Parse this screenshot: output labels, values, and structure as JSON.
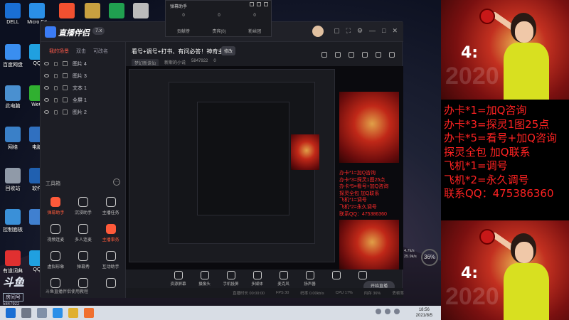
{
  "desktop": {
    "icons": [
      {
        "label": "DELL",
        "color": "#1a6fd4"
      },
      {
        "label": "Micro Ed",
        "color": "#2a8fe8"
      },
      {
        "label": "",
        "color": "#f25030"
      },
      {
        "label": "",
        "color": "#c8a040"
      },
      {
        "label": "",
        "color": "#20a050"
      },
      {
        "label": "",
        "color": "#bbbbbb"
      },
      {
        "label": "百度网盘",
        "color": "#3a8ef0"
      },
      {
        "label": "QQ",
        "color": "#20a0e0"
      },
      {
        "label": "此电脑",
        "color": "#4a90d0"
      },
      {
        "label": "WeC",
        "color": "#30b030"
      },
      {
        "label": "网络",
        "color": "#3a80c8"
      },
      {
        "label": "电脑",
        "color": "#3070c0"
      },
      {
        "label": "回收站",
        "color": "#909aa8"
      },
      {
        "label": "软件",
        "color": "#2060b0"
      },
      {
        "label": "控制面板",
        "color": "#3a90d8"
      },
      {
        "label": "",
        "color": "#4080d0"
      },
      {
        "label": "有道词典",
        "color": "#e03030"
      },
      {
        "label": "QQ",
        "color": "#20a0e0"
      }
    ]
  },
  "app": {
    "name": "直播伴侣",
    "version": "7.x",
    "controls": [
      "▢",
      "⛶",
      "⚙",
      "—",
      "□",
      "✕"
    ],
    "tabs": [
      {
        "label": "我的场景",
        "active": true
      },
      {
        "label": "双击",
        "active": false
      },
      {
        "label": "可改名",
        "active": false
      }
    ],
    "scene_items": [
      "图片 4",
      "图片 3",
      "文本 1",
      "全屏 1",
      "图片 2"
    ],
    "toolbox_title": "工具箱",
    "tools": [
      {
        "label": "弹幕助手",
        "red": true
      },
      {
        "label": "沉浸助手",
        "red": false
      },
      {
        "label": "主播任务",
        "red": false
      },
      {
        "label": "视频连麦",
        "red": false
      },
      {
        "label": "多人连麦",
        "red": false
      },
      {
        "label": "主播事务",
        "red": true
      },
      {
        "label": "虚拟形象",
        "red": false
      },
      {
        "label": "弹幕秀",
        "red": false
      },
      {
        "label": "互动助手",
        "red": false
      },
      {
        "label": "",
        "red": false
      },
      {
        "label": "",
        "red": false
      },
      {
        "label": "",
        "red": false
      }
    ],
    "sidebar_footer": "斗鱼直播伴侣使用教程",
    "room": {
      "title": "看号+调号+打书、有问必答！神奇主播！",
      "edit_label": "修改",
      "category": "梦幻新诛仙",
      "streamer": "新斯的小说",
      "room_id": "5847922",
      "likes": "0"
    },
    "bottom_tools": [
      "资源屏幕",
      "摄像头",
      "手机投屏",
      "多媒体",
      "麦克风",
      "扬声器",
      "",
      ""
    ],
    "live_button": "开始直播",
    "status": [
      "直播时长 00:00:00",
      "FPS 30",
      "码率 0.00kb/s",
      "CPU 17%",
      "内存 36%",
      "丢帧率"
    ]
  },
  "popup": {
    "title": "弹幕助手",
    "counts": [
      "0",
      "0",
      "0"
    ],
    "tabs": [
      "贡献榜",
      "贵宾(0)",
      "粉丝团"
    ]
  },
  "right_panel": {
    "score_text": "4:",
    "year_text": "2020",
    "lines": [
      "办卡*1=加Q咨询",
      "办卡*3=探灵1图25点",
      "办卡*5=看号+加Q咨询",
      "探灵全包 加Q联系",
      "飞机*1=调号",
      "飞机*2=永久调号",
      "联系QQ：475386360"
    ]
  },
  "float_widget": {
    "speed_up": "4.7k/s",
    "speed_down": "25.9k/s",
    "percent": "36%"
  },
  "taskbar": {
    "time": "18:56",
    "date": "2021/8/5"
  },
  "watermark": {
    "main": "斗鱼",
    "sub": "房间号",
    "id": "5847922"
  }
}
